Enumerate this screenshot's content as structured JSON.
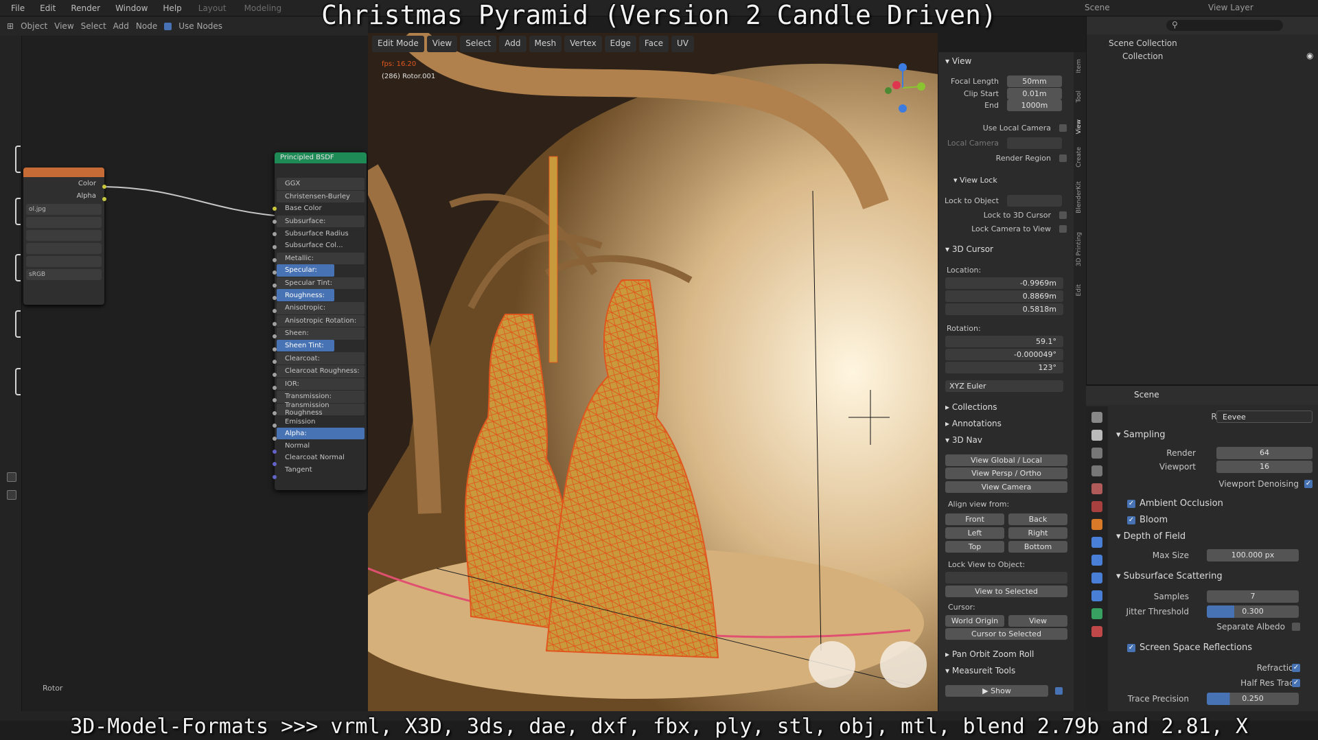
{
  "video": {
    "title": "Christmas Pyramid (Version 2 Candle Driven)",
    "caption": "3D-Model-Formats >>> vrml, X3D, 3ds, dae, dxf, fbx, ply, stl, obj, mtl, blend 2.79b and 2.81, X"
  },
  "topbar": {
    "menus": [
      "File",
      "Edit",
      "Render",
      "Window",
      "Help"
    ],
    "workspace_tabs": [
      "Layout",
      "Modeling"
    ],
    "scene_label": "Scene",
    "view_layer_label": "View Layer"
  },
  "node_editor": {
    "header_items": [
      "Object",
      "View",
      "Select",
      "Add",
      "Node",
      "Use Nodes"
    ],
    "image_node": {
      "outputs": [
        "Color",
        "Alpha"
      ],
      "image_name": "ol.jpg",
      "colorspace": "sRGB"
    },
    "bsdf_node": {
      "title": "Principled BSDF",
      "fields": [
        "GGX",
        "Christensen-Burley"
      ],
      "inputs": [
        "Base Color",
        "Subsurface:",
        "Subsurface Radius",
        "Subsurface Col...",
        "Metallic:",
        "Specular:",
        "Specular Tint:",
        "Roughness:",
        "Anisotropic:",
        "Anisotropic Rotation:",
        "Sheen:",
        "Sheen Tint:",
        "Clearcoat:",
        "Clearcoat Roughness:",
        "IOR:",
        "Transmission:",
        "Transmission Roughness",
        "Emission",
        "Alpha:",
        "Normal",
        "Clearcoat Normal",
        "Tangent"
      ],
      "highlighted": [
        "Specular:",
        "Roughness:",
        "Sheen Tint:"
      ],
      "highlighted_full": [
        "Alpha:"
      ]
    },
    "footer_label": "Rotor"
  },
  "viewport": {
    "mode": "Edit Mode",
    "menus": [
      "View",
      "Select",
      "Add",
      "Mesh",
      "Vertex",
      "Edge",
      "Face",
      "UV"
    ],
    "fps_text": "fps: 16.20",
    "object_text": "(286) Rotor.001",
    "colors": {
      "wire": "#e0561e",
      "mesh": "#c99a3c",
      "dome": "#7a5630"
    }
  },
  "npanel": {
    "tabs": [
      "Item",
      "Tool",
      "View",
      "Create",
      "BlenderKit",
      "3D Printing",
      "Edit"
    ],
    "view_section": "View",
    "focal_length_label": "Focal Length",
    "focal_length": "50mm",
    "clip_start_label": "Clip Start",
    "clip_start": "0.01m",
    "clip_end_label": "End",
    "clip_end": "1000m",
    "use_local_camera": "Use Local Camera",
    "local_camera": "Local Camera",
    "render_region": "Render Region",
    "view_lock_section": "View Lock",
    "lock_to_object": "Lock to Object",
    "lock_to_3d_cursor": "Lock to 3D Cursor",
    "lock_camera_to_view": "Lock Camera to View",
    "cursor_section": "3D Cursor",
    "location_label": "Location:",
    "loc_x": "-0.9969m",
    "loc_y": "0.8869m",
    "loc_z": "0.5818m",
    "rotation_label": "Rotation:",
    "rot_x": "59.1°",
    "rot_y": "-0.000049°",
    "rot_z": "123°",
    "rotation_mode": "XYZ Euler",
    "collections": "Collections",
    "annotations": "Annotations",
    "nav_section": "3D Nav",
    "view_global_local": "View Global / Local",
    "view_persp_ortho": "View Persp / Ortho",
    "view_camera": "View Camera",
    "align_view_from": "Align view from:",
    "align_buttons": [
      "Front",
      "Back",
      "Left",
      "Right",
      "Top",
      "Bottom"
    ],
    "lock_view_to_object": "Lock View to Object:",
    "view_to_selected": "View to Selected",
    "cursor_label": "Cursor:",
    "world_origin": "World Origin",
    "view_btn": "View",
    "cursor_to_selected": "Cursor to Selected",
    "pan_orbit": "Pan Orbit Zoom Roll",
    "measure_tools": "Measureit Tools",
    "show_btn": "Show"
  },
  "outliner": {
    "scene_collection": "Scene Collection",
    "collection": "Collection"
  },
  "properties": {
    "scene_label": "Scene",
    "render_engine_label": "Render Engine",
    "render_engine": "Eevee",
    "sampling": "Sampling",
    "render_label": "Render",
    "render_value": "64",
    "viewport_label": "Viewport",
    "viewport_value": "16",
    "viewport_denoising": "Viewport Denoising",
    "ambient_occlusion": "Ambient Occlusion",
    "bloom": "Bloom",
    "depth_of_field": "Depth of Field",
    "max_size_label": "Max Size",
    "max_size": "100.000 px",
    "sss": "Subsurface Scattering",
    "samples_label": "Samples",
    "samples": "7",
    "jitter_label": "Jitter Threshold",
    "jitter": "0.300",
    "separate_albedo": "Separate Albedo",
    "ssr": "Screen Space Reflections",
    "refraction": "Refraction",
    "half_res": "Half Res Trace",
    "trace_precision_label": "Trace Precision",
    "trace_precision": "0.250"
  }
}
